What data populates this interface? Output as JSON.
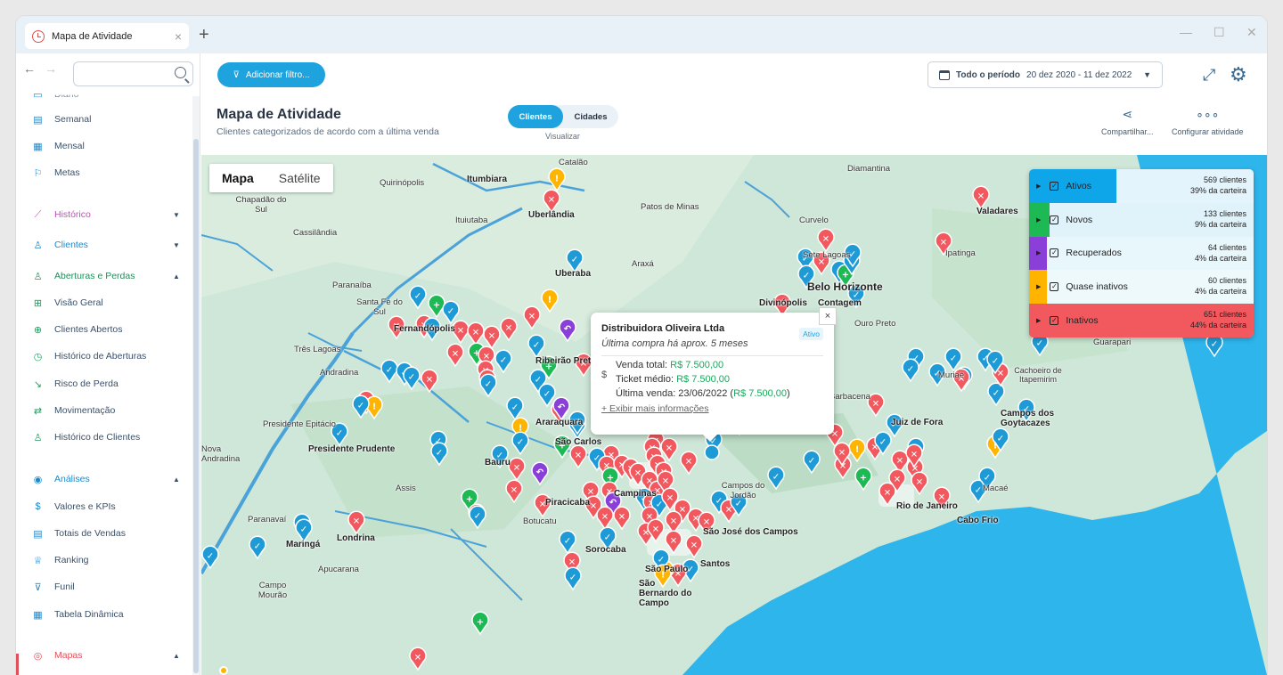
{
  "browser": {
    "tab_title": "Mapa de Atividade",
    "tab_close": "×",
    "new_tab": "+"
  },
  "sidebar": {
    "partial_top": "Diário",
    "items": [
      {
        "label": "Semanal"
      },
      {
        "label": "Mensal"
      },
      {
        "label": "Metas"
      },
      {
        "label": "Histórico"
      },
      {
        "label": "Clientes"
      },
      {
        "label": "Aberturas e Perdas"
      },
      {
        "label": "Visão Geral"
      },
      {
        "label": "Clientes Abertos"
      },
      {
        "label": "Histórico de Aberturas"
      },
      {
        "label": "Risco de Perda"
      },
      {
        "label": "Movimentação"
      },
      {
        "label": "Histórico de Clientes"
      },
      {
        "label": "Análises"
      },
      {
        "label": "Valores e KPIs"
      },
      {
        "label": "Totais de Vendas"
      },
      {
        "label": "Ranking"
      },
      {
        "label": "Funil"
      },
      {
        "label": "Tabela Dinâmica"
      },
      {
        "label": "Mapas"
      }
    ]
  },
  "toolbar": {
    "filter_label": "Adicionar filtro...",
    "period_label": "Todo o período",
    "period_range": "20 dez 2020 - 11 dez 2022"
  },
  "page": {
    "title": "Mapa de Atividade",
    "subtitle": "Clientes categorizados de acordo com a última venda",
    "toggle_clientes": "Clientes",
    "toggle_cidades": "Cidades",
    "toggle_caption": "Visualizar",
    "share_label": "Compartilhar...",
    "config_label": "Configurar atividade"
  },
  "map": {
    "type_map": "Mapa",
    "type_satellite": "Satélite",
    "cities": [
      {
        "name": "Catalão"
      },
      {
        "name": "Diamantina"
      },
      {
        "name": "Quirinópolis"
      },
      {
        "name": "Itumbiara"
      },
      {
        "name": "Chapadão do Sul"
      },
      {
        "name": "Uberlândia"
      },
      {
        "name": "Patos de Minas"
      },
      {
        "name": "Curvelo"
      },
      {
        "name": "Valadares"
      },
      {
        "name": "Cassilândia"
      },
      {
        "name": "Ituiutaba"
      },
      {
        "name": "Sete Lagoas"
      },
      {
        "name": "Ipatinga"
      },
      {
        "name": "Paranaíba"
      },
      {
        "name": "Uberaba"
      },
      {
        "name": "Araxá"
      },
      {
        "name": "Belo Horizonte"
      },
      {
        "name": "Santa Fé do Sul"
      },
      {
        "name": "Divinópolis"
      },
      {
        "name": "Contagem"
      },
      {
        "name": "Ouro Preto"
      },
      {
        "name": "Fernandópolis"
      },
      {
        "name": "Três Lagoas"
      },
      {
        "name": "Andradina"
      },
      {
        "name": "Ribeirão Preto"
      },
      {
        "name": "Barbacena"
      },
      {
        "name": "Guarapari"
      },
      {
        "name": "Cachoeiro de Itapemirim"
      },
      {
        "name": "Muriaé"
      },
      {
        "name": "Campos dos Goytacazes"
      },
      {
        "name": "Juiz de Fora"
      },
      {
        "name": "Presidente Epitácio"
      },
      {
        "name": "Araraquara"
      },
      {
        "name": "São Carlos"
      },
      {
        "name": "Presidente Prudente"
      },
      {
        "name": "Nova Andradina"
      },
      {
        "name": "Bauru"
      },
      {
        "name": "Assis"
      },
      {
        "name": "Piracicaba"
      },
      {
        "name": "Campinas"
      },
      {
        "name": "Campos do Jordão"
      },
      {
        "name": "Rio de Janeiro"
      },
      {
        "name": "Macaé"
      },
      {
        "name": "Cabo Frio"
      },
      {
        "name": "Paranavaí"
      },
      {
        "name": "Botucatu"
      },
      {
        "name": "São José dos Campos"
      },
      {
        "name": "Maringá"
      },
      {
        "name": "Londrina"
      },
      {
        "name": "Sorocaba"
      },
      {
        "name": "Apucarana"
      },
      {
        "name": "Campo Mourão"
      },
      {
        "name": "São Paulo"
      },
      {
        "name": "Santos"
      },
      {
        "name": "São Bernardo do Campo"
      }
    ],
    "popup": {
      "name": "Distribuidora Oliveira Ltda",
      "badge": "Ativo",
      "last_purchase": "Última compra há aprox. 5 meses",
      "dollar": "$",
      "total_label": "Venda total:",
      "total_value": "R$ 7.500,00",
      "ticket_label": "Ticket médio:",
      "ticket_value": "R$ 7.500,00",
      "last_label": "Última venda: 23/06/2022 (",
      "last_value": "R$ 7.500,00",
      "last_close": ")",
      "more": "+ Exibir mais informações",
      "close": "×"
    },
    "legend": [
      {
        "name": "Ativos",
        "count": "569 clientes",
        "share": "39% da carteira",
        "share_value": 0.39,
        "color": "#0ea5e9",
        "row_bg": "#e4f4fc"
      },
      {
        "name": "Novos",
        "count": "133 clientes",
        "share": "9% da carteira",
        "share_value": 0.09,
        "color": "#1db954",
        "row_bg": "#e0f3fb"
      },
      {
        "name": "Recuperados",
        "count": "64 clientes",
        "share": "4% da carteira",
        "share_value": 0.04,
        "color": "#8b3fd9",
        "row_bg": "#e8f7fc"
      },
      {
        "name": "Quase inativos",
        "count": "60 clientes",
        "share": "4% da carteira",
        "share_value": 0.04,
        "color": "#ffb400",
        "row_bg": "#eef9fc"
      },
      {
        "name": "Inativos",
        "count": "651 clientes",
        "share": "44% da carteira",
        "share_value": 0.44,
        "color": "#f2595f",
        "row_bg": "#f2595f"
      }
    ]
  },
  "colors": {
    "accent": "#1ea3df",
    "inactive": "#f2595f",
    "active": "#1e9bd7",
    "new": "#1db954",
    "recovered": "#8b3fd9",
    "almost_inactive": "#ffb400"
  }
}
